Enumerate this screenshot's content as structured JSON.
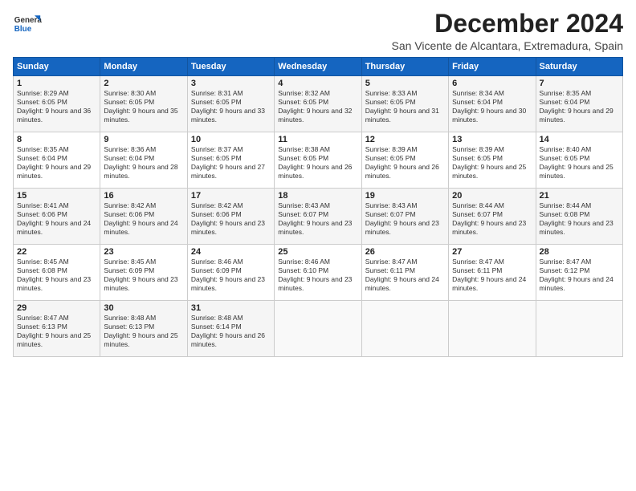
{
  "logo": {
    "general": "General",
    "blue": "Blue"
  },
  "title": "December 2024",
  "location": "San Vicente de Alcantara, Extremadura, Spain",
  "days_header": [
    "Sunday",
    "Monday",
    "Tuesday",
    "Wednesday",
    "Thursday",
    "Friday",
    "Saturday"
  ],
  "weeks": [
    [
      {
        "day": "1",
        "sunrise": "8:29 AM",
        "sunset": "6:05 PM",
        "daylight": "9 hours and 36 minutes."
      },
      {
        "day": "2",
        "sunrise": "8:30 AM",
        "sunset": "6:05 PM",
        "daylight": "9 hours and 35 minutes."
      },
      {
        "day": "3",
        "sunrise": "8:31 AM",
        "sunset": "6:05 PM",
        "daylight": "9 hours and 33 minutes."
      },
      {
        "day": "4",
        "sunrise": "8:32 AM",
        "sunset": "6:05 PM",
        "daylight": "9 hours and 32 minutes."
      },
      {
        "day": "5",
        "sunrise": "8:33 AM",
        "sunset": "6:05 PM",
        "daylight": "9 hours and 31 minutes."
      },
      {
        "day": "6",
        "sunrise": "8:34 AM",
        "sunset": "6:04 PM",
        "daylight": "9 hours and 30 minutes."
      },
      {
        "day": "7",
        "sunrise": "8:35 AM",
        "sunset": "6:04 PM",
        "daylight": "9 hours and 29 minutes."
      }
    ],
    [
      {
        "day": "8",
        "sunrise": "8:35 AM",
        "sunset": "6:04 PM",
        "daylight": "9 hours and 29 minutes."
      },
      {
        "day": "9",
        "sunrise": "8:36 AM",
        "sunset": "6:04 PM",
        "daylight": "9 hours and 28 minutes."
      },
      {
        "day": "10",
        "sunrise": "8:37 AM",
        "sunset": "6:05 PM",
        "daylight": "9 hours and 27 minutes."
      },
      {
        "day": "11",
        "sunrise": "8:38 AM",
        "sunset": "6:05 PM",
        "daylight": "9 hours and 26 minutes."
      },
      {
        "day": "12",
        "sunrise": "8:39 AM",
        "sunset": "6:05 PM",
        "daylight": "9 hours and 26 minutes."
      },
      {
        "day": "13",
        "sunrise": "8:39 AM",
        "sunset": "6:05 PM",
        "daylight": "9 hours and 25 minutes."
      },
      {
        "day": "14",
        "sunrise": "8:40 AM",
        "sunset": "6:05 PM",
        "daylight": "9 hours and 25 minutes."
      }
    ],
    [
      {
        "day": "15",
        "sunrise": "8:41 AM",
        "sunset": "6:06 PM",
        "daylight": "9 hours and 24 minutes."
      },
      {
        "day": "16",
        "sunrise": "8:42 AM",
        "sunset": "6:06 PM",
        "daylight": "9 hours and 24 minutes."
      },
      {
        "day": "17",
        "sunrise": "8:42 AM",
        "sunset": "6:06 PM",
        "daylight": "9 hours and 23 minutes."
      },
      {
        "day": "18",
        "sunrise": "8:43 AM",
        "sunset": "6:07 PM",
        "daylight": "9 hours and 23 minutes."
      },
      {
        "day": "19",
        "sunrise": "8:43 AM",
        "sunset": "6:07 PM",
        "daylight": "9 hours and 23 minutes."
      },
      {
        "day": "20",
        "sunrise": "8:44 AM",
        "sunset": "6:07 PM",
        "daylight": "9 hours and 23 minutes."
      },
      {
        "day": "21",
        "sunrise": "8:44 AM",
        "sunset": "6:08 PM",
        "daylight": "9 hours and 23 minutes."
      }
    ],
    [
      {
        "day": "22",
        "sunrise": "8:45 AM",
        "sunset": "6:08 PM",
        "daylight": "9 hours and 23 minutes."
      },
      {
        "day": "23",
        "sunrise": "8:45 AM",
        "sunset": "6:09 PM",
        "daylight": "9 hours and 23 minutes."
      },
      {
        "day": "24",
        "sunrise": "8:46 AM",
        "sunset": "6:09 PM",
        "daylight": "9 hours and 23 minutes."
      },
      {
        "day": "25",
        "sunrise": "8:46 AM",
        "sunset": "6:10 PM",
        "daylight": "9 hours and 23 minutes."
      },
      {
        "day": "26",
        "sunrise": "8:47 AM",
        "sunset": "6:11 PM",
        "daylight": "9 hours and 24 minutes."
      },
      {
        "day": "27",
        "sunrise": "8:47 AM",
        "sunset": "6:11 PM",
        "daylight": "9 hours and 24 minutes."
      },
      {
        "day": "28",
        "sunrise": "8:47 AM",
        "sunset": "6:12 PM",
        "daylight": "9 hours and 24 minutes."
      }
    ],
    [
      {
        "day": "29",
        "sunrise": "8:47 AM",
        "sunset": "6:13 PM",
        "daylight": "9 hours and 25 minutes."
      },
      {
        "day": "30",
        "sunrise": "8:48 AM",
        "sunset": "6:13 PM",
        "daylight": "9 hours and 25 minutes."
      },
      {
        "day": "31",
        "sunrise": "8:48 AM",
        "sunset": "6:14 PM",
        "daylight": "9 hours and 26 minutes."
      },
      null,
      null,
      null,
      null
    ]
  ],
  "labels": {
    "sunrise": "Sunrise:",
    "sunset": "Sunset:",
    "daylight": "Daylight:"
  }
}
